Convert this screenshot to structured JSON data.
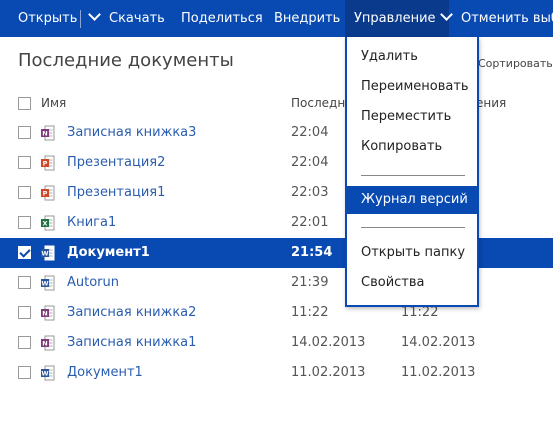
{
  "toolbar": {
    "open": "Открыть",
    "download": "Скачать",
    "share": "Поделиться",
    "embed": "Внедрить",
    "manage": "Управление",
    "undo": "Отменить выбор"
  },
  "page_title": "Последние документы",
  "sort_label": "Сортировать п",
  "columns": {
    "name": "Имя",
    "modified": "Последн",
    "col2": "ения"
  },
  "documents": [
    {
      "name": "Записная книжка3",
      "modified": "22:04",
      "col2": "",
      "type": "onenote"
    },
    {
      "name": "Презентация2",
      "modified": "22:04",
      "col2": "",
      "type": "powerpoint"
    },
    {
      "name": "Презентация1",
      "modified": "22:03",
      "col2": "",
      "type": "powerpoint"
    },
    {
      "name": "Книга1",
      "modified": "22:01",
      "col2": "",
      "type": "excel"
    },
    {
      "name": "Документ1",
      "modified": "21:54",
      "col2": "",
      "type": "word",
      "selected": true
    },
    {
      "name": "Autorun",
      "modified": "21:39",
      "col2": "",
      "type": "word"
    },
    {
      "name": "Записная книжка2",
      "modified": "11:22",
      "col2": "11:22",
      "type": "onenote"
    },
    {
      "name": "Записная книжка1",
      "modified": "14.02.2013",
      "col2": "14.02.2013",
      "type": "onenote"
    },
    {
      "name": "Документ1",
      "modified": "11.02.2013",
      "col2": "11.02.2013",
      "type": "word"
    }
  ],
  "menu": {
    "delete": "Удалить",
    "rename": "Переименовать",
    "move": "Переместить",
    "copy": "Копировать",
    "version_history": "Журнал версий",
    "open_folder": "Открыть папку",
    "properties": "Свойства"
  },
  "colors": {
    "accent": "#094ab2",
    "onenote": "#80397b",
    "powerpoint": "#d24726",
    "excel": "#207245",
    "word": "#2b579a"
  }
}
